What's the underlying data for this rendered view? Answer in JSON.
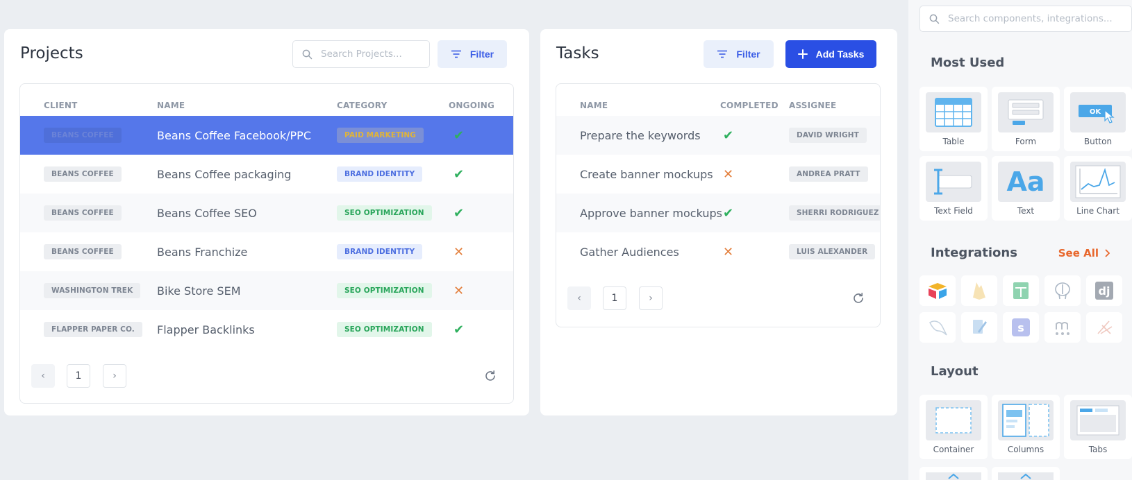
{
  "projects": {
    "title": "Projects",
    "search_placeholder": "Search Projects...",
    "filter_label": "Filter",
    "columns": [
      "CLIENT",
      "NAME",
      "CATEGORY",
      "ONGOING"
    ],
    "rows": [
      {
        "client": "BEANS COFFEE",
        "name": "Beans Coffee Facebook/PPC",
        "category": "PAID MARKETING",
        "ongoing": "✔"
      },
      {
        "client": "BEANS COFFEE",
        "name": "Beans Coffee packaging",
        "category": "BRAND IDENTITY",
        "ongoing": "✔"
      },
      {
        "client": "BEANS COFFEE",
        "name": "Beans Coffee SEO",
        "category": "SEO OPTIMIZATION",
        "ongoing": "✔"
      },
      {
        "client": "BEANS COFFEE",
        "name": "Beans Franchize",
        "category": "BRAND IDENTITY",
        "ongoing": "✕"
      },
      {
        "client": "WASHINGTON TREK",
        "name": "Bike Store SEM",
        "category": "SEO OPTIMIZATION",
        "ongoing": "✕"
      },
      {
        "client": "FLAPPER PAPER CO.",
        "name": "Flapper Backlinks",
        "category": "SEO OPTIMIZATION",
        "ongoing": "✔"
      }
    ],
    "pager": {
      "prev": "‹",
      "page": "1",
      "next": "›"
    }
  },
  "tasks": {
    "title": "Tasks",
    "filter_label": "Filter",
    "add_label": "Add Tasks",
    "columns": [
      "NAME",
      "COMPLETED",
      "ASSIGNEE"
    ],
    "rows": [
      {
        "name": "Prepare the keywords",
        "completed": "✔",
        "assignee": "DAVID WRIGHT"
      },
      {
        "name": "Create banner mockups",
        "completed": "✕",
        "assignee": "ANDREA PRATT"
      },
      {
        "name": "Approve banner mockups",
        "completed": "✔",
        "assignee": "SHERRI RODRIGUEZ"
      },
      {
        "name": "Gather Audiences",
        "completed": "✕",
        "assignee": "LUIS ALEXANDER"
      }
    ],
    "pager": {
      "prev": "‹",
      "page": "1",
      "next": "›"
    }
  },
  "panel": {
    "search_placeholder": "Search components, integrations...",
    "most_used_title": "Most Used",
    "most_used": [
      "Table",
      "Form",
      "Button",
      "Text Field",
      "Text",
      "Line Chart"
    ],
    "button_thumb_text": "OK",
    "text_thumb_text": "Aa",
    "integrations_title": "Integrations",
    "see_all": "See All",
    "layout_title": "Layout",
    "layout": [
      "Container",
      "Columns",
      "Tabs"
    ]
  },
  "colors": {
    "accent": "#2a4fe4",
    "selected_row": "#5577ea",
    "success": "#2fb05e",
    "warning": "#e37f3c",
    "see_all": "#e8672c"
  }
}
